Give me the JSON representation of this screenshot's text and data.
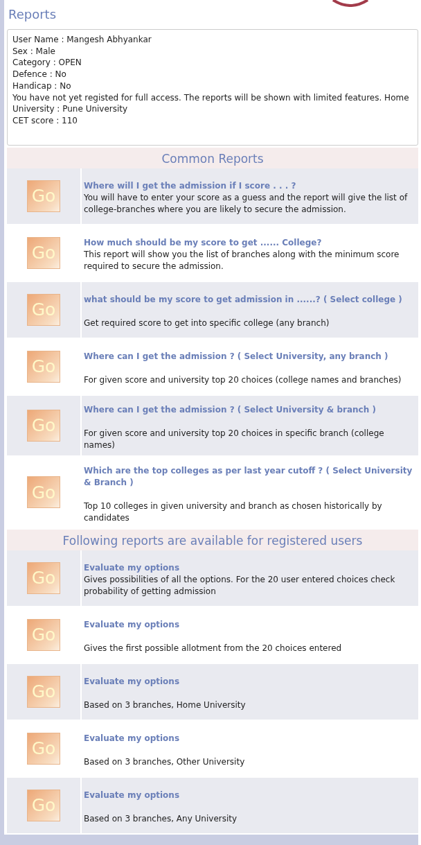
{
  "page_title": "Reports",
  "profile": {
    "lines": [
      "User Name : Mangesh Abhyankar",
      "Sex : Male",
      "Category : OPEN",
      "Defence : No",
      "Handicap : No",
      "You have not yet registed for full access. The reports will be shown with limited features. Home University : Pune University",
      "CET score : 110"
    ]
  },
  "sections": [
    {
      "heading": "Common Reports",
      "reports": [
        {
          "kind": "compact",
          "button": "Go",
          "title": "Where will I get the admission if I score . . . ?",
          "description": "You will have to enter your score as a guess and the report will give the list of college-branches where you are likely to secure the admission."
        },
        {
          "kind": "compact",
          "button": "Go",
          "title": "How much should be my score to get ...... College?",
          "description": "This report will show you the list of branches along with the minimum score required to secure the admission."
        },
        {
          "kind": "spaced",
          "button": "Go",
          "title": "what should be my score to get admission in ......? ( Select college )",
          "description": "Get required score to get into specific college (any branch)"
        },
        {
          "kind": "spaced",
          "button": "Go",
          "title": "Where can I get the admission ? ( Select University, any branch )",
          "description": "For given score and university top 20 choices (college names and branches)"
        },
        {
          "kind": "spaced",
          "button": "Go",
          "title": "Where can I get the admission ? ( Select University & branch )",
          "description": "For given score and university top 20 choices in specific branch (college names)"
        },
        {
          "kind": "spaced",
          "button": "Go",
          "title": "Which are the top colleges as per last year cutoff ? ( Select University & Branch )",
          "description": "Top 10 colleges in given university and branch as chosen historically by candidates"
        }
      ]
    },
    {
      "heading": "Following reports are available for registered users",
      "reports": [
        {
          "kind": "compact",
          "button": "Go",
          "title": "Evaluate my options",
          "description": "Gives possibilities of all the options. For the 20 user entered choices check probability of getting admission"
        },
        {
          "kind": "spaced",
          "button": "Go",
          "title": "Evaluate my options",
          "description": "Gives the first possible allotment from the 20 choices entered"
        },
        {
          "kind": "spaced",
          "button": "Go",
          "title": "Evaluate my options",
          "description": "Based on 3 branches, Home University"
        },
        {
          "kind": "spaced",
          "button": "Go",
          "title": "Evaluate my options",
          "description": "Based on 3 branches, Other University"
        },
        {
          "kind": "spaced",
          "button": "Go",
          "title": "Evaluate my options",
          "description": "Based on 3 branches, Any University"
        }
      ]
    }
  ]
}
